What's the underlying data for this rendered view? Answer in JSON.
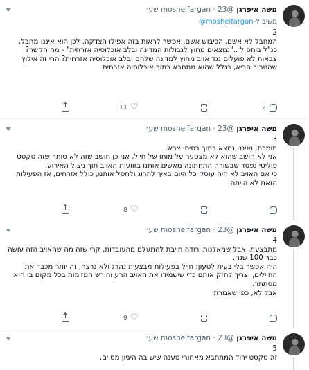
{
  "author": {
    "name": "משה איפרגן",
    "handle": "@mosheifargan",
    "dot": "·"
  },
  "tweets": [
    {
      "time": "23 שע׳",
      "replying_prefix": "משיב ל-",
      "replying_to": "mosheifargan@",
      "text": "2\nהמחבל לא אשם, הכיבוש אשם. אפשר לראות בזה אפילו הצדקה. לכן הוא איננו מחבל.\nכנ\"ל ביחס ל ..\"נמצאים מחוץ לגבולות המדינה ובלב אוכלוסיה אזרחית\" - מה הקשר? צבאות לא פועלים נגד אויב מחוץ למדינה שלהם ובלב אוכלוסיה אזרחית? הרי זה אילוץ שהטרור הביא, בגלל שהוא מתחבא בתוך אוכלוסיה אזרחית",
      "reply_count": "2",
      "retweet_count": "",
      "like_count": "11"
    },
    {
      "time": "23 שע׳",
      "text": "3\nתומכת, ואיננו נמצא בתוך בסיסי צבא.\nאני לא חושב שהוא לא מצטער על מותו של חייל, אני כן חושב שזה לא סותר שזה טקסט פוליטי נפסד שבשורה התחתונה מאשים אותנו בזוועות האויב תוך ניצול האירוע.\nכי אם האויב לא היה עוסק כל היום באיך להרוג ולחסל אותנו, כולל אזרחים, אז הפעילות הזאת לא הייתה",
      "reply_count": "",
      "retweet_count": "",
      "like_count": "8"
    },
    {
      "time": "23 שע׳",
      "text": "4\nמתבצעת, אבל שמאלנות ירודה חייבת להתעלם מהעובדות, קרי שזה מה שהאויב הזה עושה כבר 100 שנה.\nהיה אפשר בלי בעית לטעון: חייל בפעילות מבצעית נהרג ולא נרצח, זה יותר מכבד את החיילים, וצריך לחזק אותם כדי שישמידו את האויב הרע וחורש המזימות בכל מקום בו הוא מסתתר.\nאבל לא, כפי שאמרתי,",
      "reply_count": "",
      "retweet_count": "",
      "like_count": "9"
    },
    {
      "time": "23 שע׳",
      "text": "5\nזה טקסט ירוד המתחבא מאחורי טענה שיש בה היגיון מסוים.",
      "reply_count": "",
      "retweet_count": "",
      "like_count": ""
    }
  ]
}
